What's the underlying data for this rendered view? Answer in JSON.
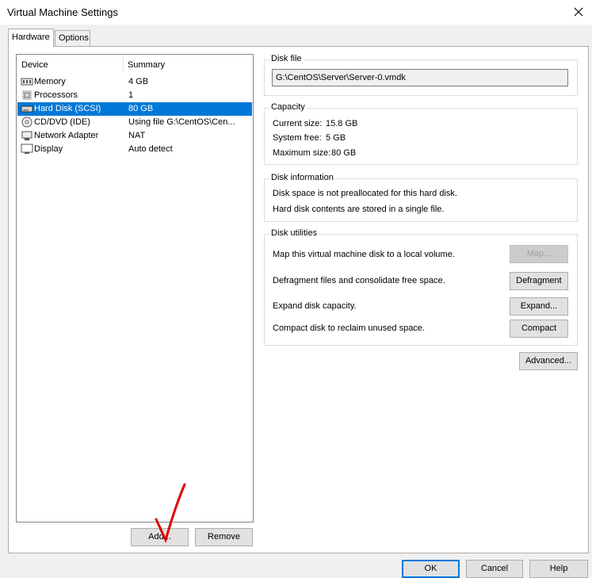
{
  "window": {
    "title": "Virtual Machine Settings"
  },
  "tabs": [
    {
      "label": "Hardware"
    },
    {
      "label": "Options"
    }
  ],
  "device_list": {
    "headers": {
      "device": "Device",
      "summary": "Summary"
    },
    "items": [
      {
        "icon": "memory-icon",
        "device": "Memory",
        "summary": "4 GB"
      },
      {
        "icon": "processor-icon",
        "device": "Processors",
        "summary": "1"
      },
      {
        "icon": "hard-disk-icon",
        "device": "Hard Disk (SCSI)",
        "summary": "80 GB",
        "selected": true
      },
      {
        "icon": "cd-dvd-icon",
        "device": "CD/DVD (IDE)",
        "summary": "Using file G:\\CentOS\\Cen..."
      },
      {
        "icon": "network-adapter-icon",
        "device": "Network Adapter",
        "summary": "NAT"
      },
      {
        "icon": "display-icon",
        "device": "Display",
        "summary": "Auto detect"
      }
    ],
    "add_label": "Add...",
    "remove_label": "Remove"
  },
  "disk_file": {
    "label": "Disk file",
    "value": "G:\\CentOS\\Server\\Server-0.vmdk"
  },
  "capacity": {
    "label": "Capacity",
    "current_size_label": "Current size:",
    "current_size": "15.8 GB",
    "system_free_label": "System free:",
    "system_free": "5 GB",
    "maximum_size_label": "Maximum size:",
    "maximum_size": "80 GB"
  },
  "disk_information": {
    "label": "Disk information",
    "line1": "Disk space is not preallocated for this hard disk.",
    "line2": "Hard disk contents are stored in a single file."
  },
  "disk_utilities": {
    "label": "Disk utilities",
    "map_text": "Map this virtual machine disk to a local volume.",
    "map_label": "Map...",
    "defrag_text": "Defragment files and consolidate free space.",
    "defrag_label": "Defragment",
    "expand_text": "Expand disk capacity.",
    "expand_label": "Expand...",
    "compact_text": "Compact disk to reclaim unused space.",
    "compact_label": "Compact"
  },
  "advanced_label": "Advanced...",
  "footer": {
    "ok_label": "OK",
    "cancel_label": "Cancel",
    "help_label": "Help"
  },
  "colors": {
    "selection": "#0078d7",
    "annotation": "#e00000"
  },
  "annotation_icon": "red-checkmark"
}
